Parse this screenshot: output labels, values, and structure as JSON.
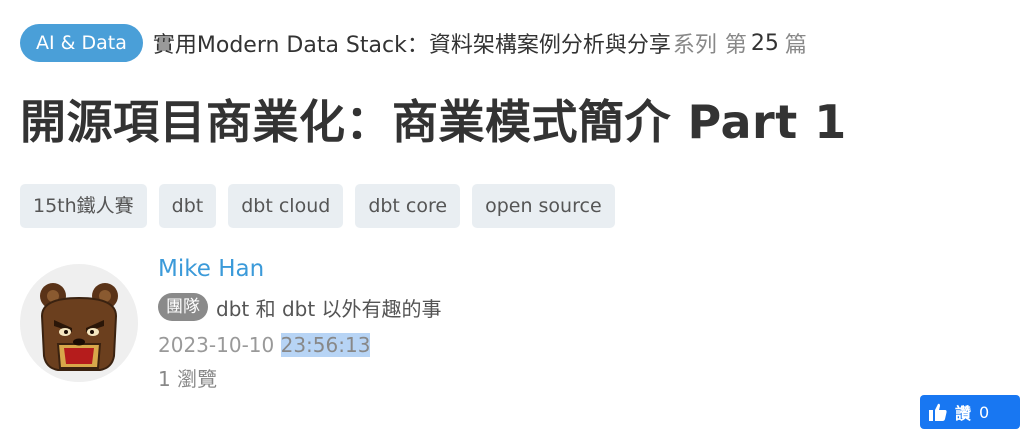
{
  "series": {
    "category": "AI & Data",
    "title": "實用Modern Data Stack：資料架構案例分析與分享",
    "suffix": "系列",
    "ordinal_prefix": "第",
    "number": "25",
    "ordinal_suffix": "篇"
  },
  "article": {
    "title": "開源項目商業化：商業模式簡介 Part 1"
  },
  "tags": [
    "15th鐵人賽",
    "dbt",
    "dbt cloud",
    "dbt core",
    "open source"
  ],
  "author": {
    "name": "Mike Han",
    "team_badge": "團隊",
    "team_name": "dbt 和 dbt 以外有趣的事",
    "date": "2023-10-10",
    "time": "23:56:13",
    "views": "1 瀏覽"
  },
  "like": {
    "icon": "thumbs-up-icon",
    "label": "讚",
    "count": "0",
    "color": "#1877f2"
  },
  "colors": {
    "category_badge": "#4a9fd8",
    "author_link": "#3b9ad9",
    "tag_bg": "#e9eef2",
    "highlight": "#b7d4f5"
  }
}
